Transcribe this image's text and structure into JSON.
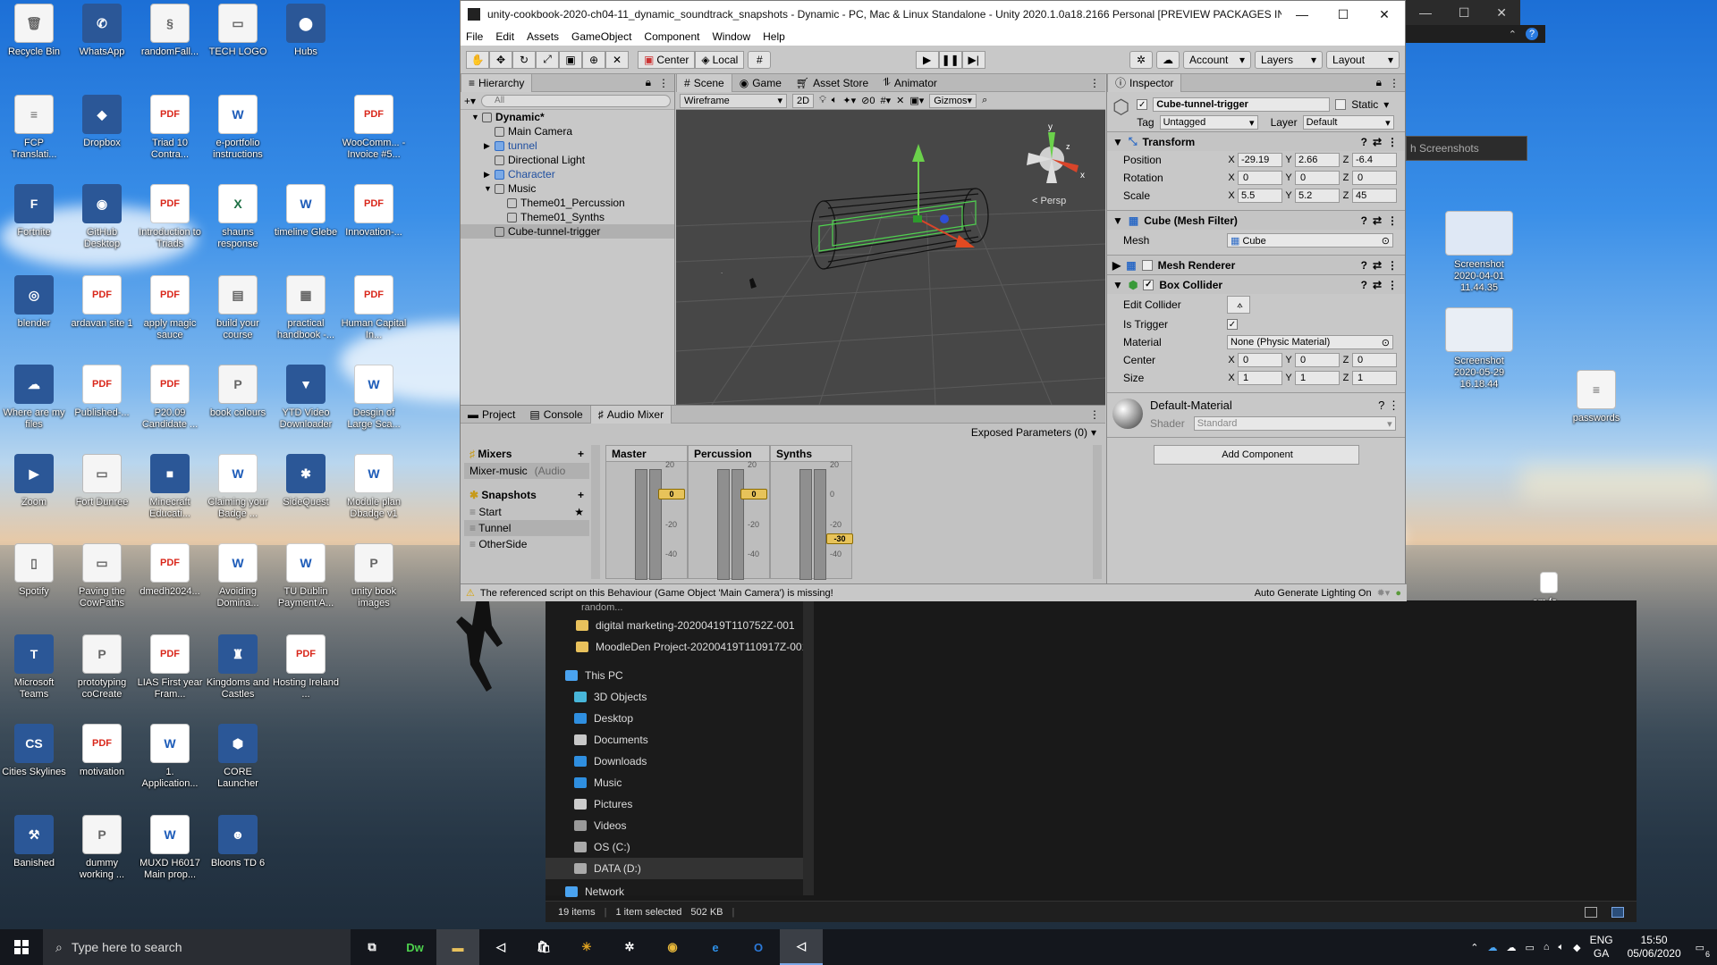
{
  "desktop": {
    "icons": [
      {
        "label": "Recycle Bin",
        "kind": "generic",
        "glyph": "🗑"
      },
      {
        "label": "WhatsApp",
        "kind": "app",
        "glyph": "✆"
      },
      {
        "label": "randomFall...",
        "kind": "generic",
        "glyph": "§"
      },
      {
        "label": "TECH LOGO",
        "kind": "generic",
        "glyph": "▭"
      },
      {
        "label": "Hubs",
        "kind": "app",
        "glyph": "⬤"
      },
      {
        "label": "FCP Translati...",
        "kind": "generic",
        "glyph": "≡"
      },
      {
        "label": "Dropbox",
        "kind": "app",
        "glyph": "◆"
      },
      {
        "label": "Triad 10 Contra...",
        "kind": "pdf",
        "glyph": "PDF"
      },
      {
        "label": "e-portfolio instructions",
        "kind": "word",
        "glyph": "W"
      },
      {
        "label": "WooComm... - Invoice #5...",
        "kind": "pdf",
        "glyph": "PDF"
      },
      {
        "label": "Fortnite",
        "kind": "app",
        "glyph": "F"
      },
      {
        "label": "GitHub Desktop",
        "kind": "app",
        "glyph": "◉"
      },
      {
        "label": "Introduction to Triads",
        "kind": "pdf",
        "glyph": "PDF"
      },
      {
        "label": "shauns response",
        "kind": "excel",
        "glyph": "X"
      },
      {
        "label": "timeline Glebe",
        "kind": "word",
        "glyph": "W"
      },
      {
        "label": "Innovation-...",
        "kind": "pdf",
        "glyph": "PDF"
      },
      {
        "label": "blender",
        "kind": "app",
        "glyph": "◎"
      },
      {
        "label": "ardavan site 1",
        "kind": "pdf",
        "glyph": "PDF"
      },
      {
        "label": "apply magic sauce",
        "kind": "pdf",
        "glyph": "PDF"
      },
      {
        "label": "build your course",
        "kind": "generic",
        "glyph": "▤"
      },
      {
        "label": "practical handbook -...",
        "kind": "generic",
        "glyph": "▦"
      },
      {
        "label": "Human Capital In...",
        "kind": "pdf",
        "glyph": "PDF"
      },
      {
        "label": "Where are my files",
        "kind": "app",
        "glyph": "☁"
      },
      {
        "label": "Published-...",
        "kind": "pdf",
        "glyph": "PDF"
      },
      {
        "label": "P20.09 Candidate ...",
        "kind": "pdf",
        "glyph": "PDF"
      },
      {
        "label": "book colours",
        "kind": "generic",
        "glyph": "P"
      },
      {
        "label": "YTD Video Downloader",
        "kind": "app",
        "glyph": "▼"
      },
      {
        "label": "Desgin of Large Sca...",
        "kind": "word",
        "glyph": "W"
      },
      {
        "label": "Zoom",
        "kind": "app",
        "glyph": "▶"
      },
      {
        "label": "Fort Dunree",
        "kind": "generic",
        "glyph": "▭"
      },
      {
        "label": "Minecraft Educati...",
        "kind": "app",
        "glyph": "■"
      },
      {
        "label": "Claiming your Badge ...",
        "kind": "word",
        "glyph": "W"
      },
      {
        "label": "SideQuest",
        "kind": "app",
        "glyph": "✱"
      },
      {
        "label": "Module plan Dbadge v1",
        "kind": "word",
        "glyph": "W"
      },
      {
        "label": "Spotify",
        "kind": "generic",
        "glyph": "▯"
      },
      {
        "label": "Paving the CowPaths",
        "kind": "generic",
        "glyph": "▭"
      },
      {
        "label": "dmedh2024...",
        "kind": "pdf",
        "glyph": "PDF"
      },
      {
        "label": "Avoiding Domina...",
        "kind": "word",
        "glyph": "W"
      },
      {
        "label": "TU Dublin Payment A...",
        "kind": "word",
        "glyph": "W"
      },
      {
        "label": "unity book images",
        "kind": "generic",
        "glyph": "P"
      },
      {
        "label": "Microsoft Teams",
        "kind": "app",
        "glyph": "T"
      },
      {
        "label": "prototyping coCreate",
        "kind": "generic",
        "glyph": "P"
      },
      {
        "label": "LIAS First year Fram...",
        "kind": "pdf",
        "glyph": "PDF"
      },
      {
        "label": "Kingdoms and Castles",
        "kind": "app",
        "glyph": "♜"
      },
      {
        "label": "Hosting Ireland ...",
        "kind": "pdf",
        "glyph": "PDF"
      },
      {
        "label": "Cities Skylines",
        "kind": "app",
        "glyph": "CS"
      },
      {
        "label": "motivation",
        "kind": "pdf",
        "glyph": "PDF"
      },
      {
        "label": "1. Application...",
        "kind": "word",
        "glyph": "W"
      },
      {
        "label": "CORE Launcher",
        "kind": "app",
        "glyph": "⬢"
      },
      {
        "label": "Banished",
        "kind": "app",
        "glyph": "⚒"
      },
      {
        "label": "dummy working ...",
        "kind": "generic",
        "glyph": "P"
      },
      {
        "label": "MUXD H6017 Main prop...",
        "kind": "word",
        "glyph": "W"
      },
      {
        "label": "Bloons TD 6",
        "kind": "app",
        "glyph": "☻"
      }
    ],
    "right_icons": [
      {
        "label": "Screenshot 2020-04-01 11.44.35"
      },
      {
        "label": "Screenshot 2020-05-29 16.18.44"
      },
      {
        "label": "passwords"
      }
    ],
    "partial_label": "em fo..."
  },
  "unity": {
    "title": "unity-cookbook-2020-ch04-11_dynamic_soundtrack_snapshots - Dynamic - PC, Mac & Linux Standalone - Unity 2020.1.0a18.2166 Personal [PREVIEW PACKAGES IN USE...",
    "menu": [
      "File",
      "Edit",
      "Assets",
      "GameObject",
      "Component",
      "Window",
      "Help"
    ],
    "toolbar": {
      "center": "Center",
      "local": "Local",
      "account": "Account",
      "layers": "Layers",
      "layout": "Layout"
    },
    "hierarchy": {
      "tab": "Hierarchy",
      "search_placeholder": "All",
      "rows": [
        {
          "label": "Dynamic*",
          "indent": 0,
          "bold": true
        },
        {
          "label": "Main Camera",
          "indent": 1
        },
        {
          "label": "tunnel",
          "indent": 1,
          "blue": true
        },
        {
          "label": "Directional Light",
          "indent": 1
        },
        {
          "label": "Character",
          "indent": 1,
          "blue": true
        },
        {
          "label": "Music",
          "indent": 1
        },
        {
          "label": "Theme01_Percussion",
          "indent": 2
        },
        {
          "label": "Theme01_Synths",
          "indent": 2
        },
        {
          "label": "Cube-tunnel-trigger",
          "indent": 1,
          "selected": true
        }
      ]
    },
    "scene_tabs": [
      "Scene",
      "Game",
      "Asset Store",
      "Animator"
    ],
    "scene_tools": {
      "shading": "Wireframe",
      "mode2d": "2D",
      "hidden_count": "0",
      "gizmos": "Gizmos",
      "persp": "< Persp"
    },
    "bottom_tabs": [
      "Project",
      "Console",
      "Audio Mixer"
    ],
    "mixer": {
      "exposed": "Exposed Parameters (0)",
      "mixers_label": "Mixers",
      "mixer_item": "Mixer-music",
      "mixer_item_note": "(Audio",
      "snapshots_label": "Snapshots",
      "snapshots": [
        "Start",
        "Tunnel",
        "OtherSide"
      ],
      "strips": [
        {
          "name": "Master",
          "fader": "0",
          "level_db": 0
        },
        {
          "name": "Percussion",
          "fader": "0",
          "level_db": 0
        },
        {
          "name": "Synths",
          "fader": "-30",
          "level_db": -30
        }
      ],
      "scale": [
        "20",
        "0",
        "-20",
        "-40"
      ]
    },
    "status": {
      "message": "The referenced script on this Behaviour (Game Object 'Main Camera') is missing!",
      "lighting": "Auto Generate Lighting On"
    },
    "inspector": {
      "tab": "Inspector",
      "object_name": "Cube-tunnel-trigger",
      "static_label": "Static",
      "tag_label": "Tag",
      "tag_value": "Untagged",
      "layer_label": "Layer",
      "layer_value": "Default",
      "transform": {
        "title": "Transform",
        "position": {
          "label": "Position",
          "x": "-29.19",
          "y": "2.66",
          "z": "-6.4"
        },
        "rotation": {
          "label": "Rotation",
          "x": "0",
          "y": "0",
          "z": "0"
        },
        "scale": {
          "label": "Scale",
          "x": "5.5",
          "y": "5.2",
          "z": "45"
        }
      },
      "mesh_filter": {
        "title": "Cube (Mesh Filter)",
        "mesh_label": "Mesh",
        "mesh_value": "Cube"
      },
      "mesh_renderer": {
        "title": "Mesh Renderer"
      },
      "box_collider": {
        "title": "Box Collider",
        "edit_label": "Edit Collider",
        "is_trigger_label": "Is Trigger",
        "material_label": "Material",
        "material_value": "None (Physic Material)",
        "center": {
          "label": "Center",
          "x": "0",
          "y": "0",
          "z": "0"
        },
        "size": {
          "label": "Size",
          "x": "1",
          "y": "1",
          "z": "1"
        }
      },
      "material": {
        "name": "Default-Material",
        "shader_label": "Shader",
        "shader_value": "Standard"
      },
      "add_component": "Add Component"
    }
  },
  "explorer": {
    "partial_top": "random...",
    "files": [
      "digital marketing-20200419T110752Z-001",
      "MoodleDen Project-20200419T110917Z-001"
    ],
    "nav": [
      {
        "label": "This PC",
        "indent": 0
      },
      {
        "label": "3D Objects",
        "indent": 1
      },
      {
        "label": "Desktop",
        "indent": 1
      },
      {
        "label": "Documents",
        "indent": 1
      },
      {
        "label": "Downloads",
        "indent": 1
      },
      {
        "label": "Music",
        "indent": 1
      },
      {
        "label": "Pictures",
        "indent": 1
      },
      {
        "label": "Videos",
        "indent": 1
      },
      {
        "label": "OS (C:)",
        "indent": 1
      },
      {
        "label": "DATA (D:)",
        "indent": 1,
        "selected": true
      },
      {
        "label": "Network",
        "indent": 0
      }
    ],
    "status": {
      "items": "19 items",
      "selected": "1 item selected",
      "size": "502 KB"
    }
  },
  "window2": {
    "search": "h Screenshots"
  },
  "taskbar": {
    "search_placeholder": "Type here to search",
    "apps": [
      "task-view",
      "Dw",
      "explorer",
      "unity",
      "store",
      "slack",
      "settings",
      "chrome",
      "edge",
      "outlook",
      "unity-active"
    ],
    "tray": {
      "lang1": "ENG",
      "lang2": "GA",
      "time": "15:50",
      "date": "05/06/2020",
      "notifications": "6"
    }
  },
  "colors": {
    "unity_bg": "#c2c2c2",
    "selected_row": "#b0b0b0",
    "fader": "#e7c35a",
    "taskbar": "#14171d"
  }
}
